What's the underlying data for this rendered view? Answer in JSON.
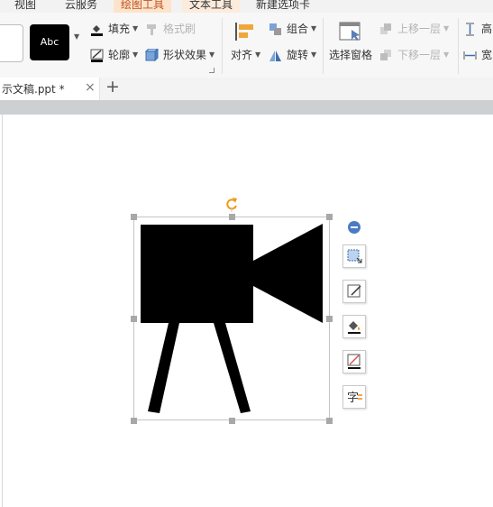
{
  "menu_tabs": [
    {
      "label": "视图",
      "active": false
    },
    {
      "label": "云服务",
      "active": false
    },
    {
      "label": "绘图工具",
      "active": true
    },
    {
      "label": "文本工具",
      "active": false
    },
    {
      "label": "新建选项卡",
      "active": false
    }
  ],
  "ribbon": {
    "style_preview_text": "Abc",
    "fill_label": "填充",
    "format_painter_label": "格式刷",
    "outline_label": "轮廓",
    "shape_effects_label": "形状效果",
    "align_label": "对齐",
    "group_label": "组合",
    "rotate_label": "旋转",
    "selection_pane_label": "选择窗格",
    "bring_forward_label": "上移一层",
    "send_backward_label": "下移一层",
    "height_label": "高",
    "width_label": "宽"
  },
  "document_tab": {
    "title": "示文稿.ppt *",
    "close": "×",
    "new_tab": "+"
  },
  "side_tools": [
    "shape-select",
    "edit-shape",
    "fill",
    "outline",
    "text-wrap"
  ],
  "colors": {
    "accent": "#c0531f",
    "shape": "#000000",
    "handle": "#a8a8a8"
  }
}
